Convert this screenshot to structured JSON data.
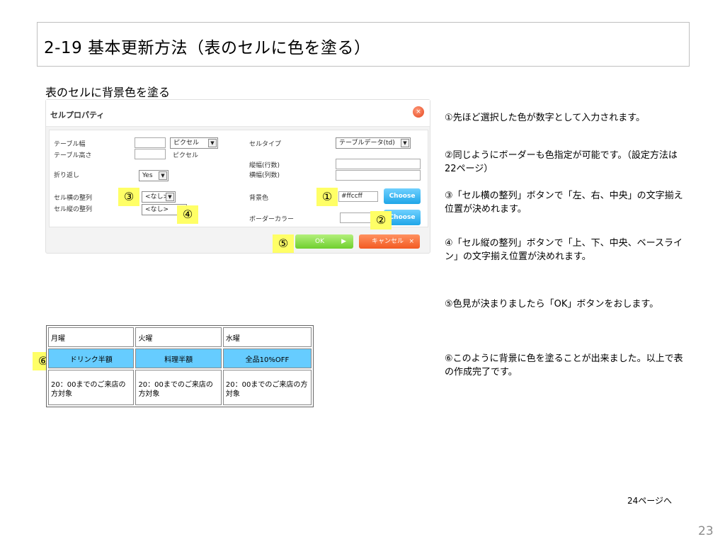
{
  "slide": {
    "title": "2-19 基本更新方法（表のセルに色を塗る）",
    "subtitle": "表のセルに背景色を塗る",
    "next_link": "24ページへ",
    "page_number": "23"
  },
  "dialog": {
    "title": "セルプロパティ",
    "close_icon": "×",
    "labels": {
      "table_width": "テーブル幅",
      "table_height": "テーブル高さ",
      "wrap": "折り返し",
      "h_align": "セル横の整列",
      "v_align": "セル縦の整列",
      "cell_type": "セルタイプ",
      "rowspan": "縦幅(行数)",
      "colspan": "横幅(列数)",
      "bg_color": "背景色",
      "border_color": "ボーダーカラー"
    },
    "width_unit": "ピクセル",
    "height_unit": "ピクセル",
    "wrap_value": "Yes",
    "h_align_value": "<なし>",
    "v_align_value": "<なし>",
    "cell_type_value": "テーブルデータ(td)",
    "bg_color_value": "#ffccff",
    "choose_label": "Choose",
    "ok_label": "OK",
    "cancel_label": "キャンセル",
    "arrow": "▼",
    "ok_arrow": "▶",
    "cancel_x": "×"
  },
  "markers": [
    "①",
    "②",
    "③",
    "④",
    "⑤",
    "⑥"
  ],
  "notes": [
    "①先ほど選択した色が数字として入力されます。",
    "②同じようにボーダーも色指定が可能です。（設定方法は22ページ）",
    "③「セル横の整列」ボタンで「左、右、中央」の文字揃え位置が決めれます。",
    "④「セル縦の整列」ボタンで「上、下、中央、ベースライン」の文字揃え位置が決めれます。",
    "⑤色見が決まりましたら「OK」ボタンをおします。",
    "⑥このように背景に色を塗ることが出来ました。以上で表の作成完了です。"
  ],
  "sample_table": {
    "headers": [
      "月曜",
      "火曜",
      "水曜"
    ],
    "colored_row": [
      "ドリンク半額",
      "料理半額",
      "全品10%OFF"
    ],
    "colored_row_color": "#66ccff",
    "footer_row": [
      "20：00までのご来店の方対象",
      "20：00までのご来店の方対象",
      "20：00までのご来店の方対象"
    ]
  },
  "colors": {
    "marker": "#ffff66",
    "choose": "#1fa6e8",
    "ok": "#6fcf2e",
    "cancel": "#f25a22",
    "close": "#e5461e"
  }
}
